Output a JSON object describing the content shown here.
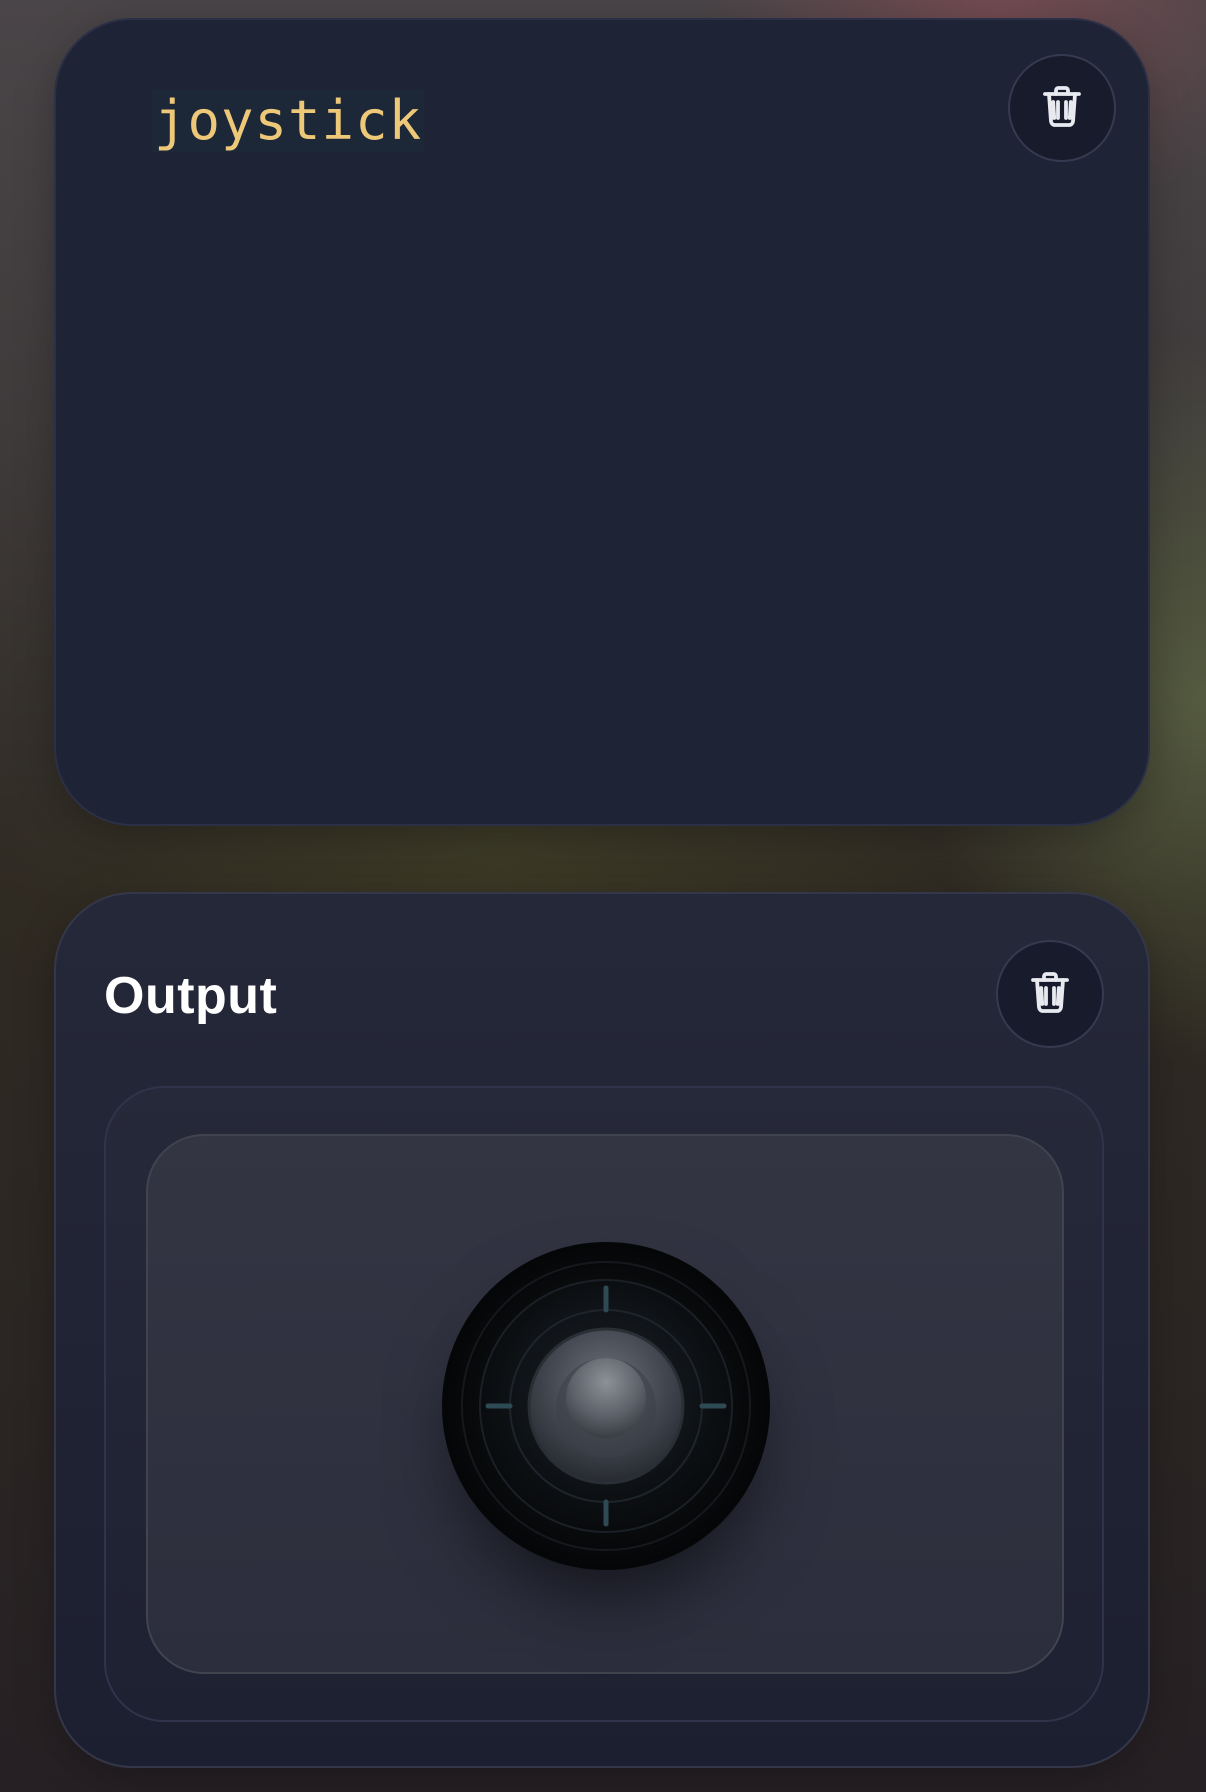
{
  "code_card": {
    "code": "joystick",
    "delete_icon": "trash-icon"
  },
  "output_card": {
    "title": "Output",
    "delete_icon": "trash-icon",
    "joystick": {
      "x": 0,
      "y": 0
    }
  },
  "colors": {
    "code_text": "#ecc878",
    "card_bg": "#1f2336",
    "title": "#ffffff"
  }
}
